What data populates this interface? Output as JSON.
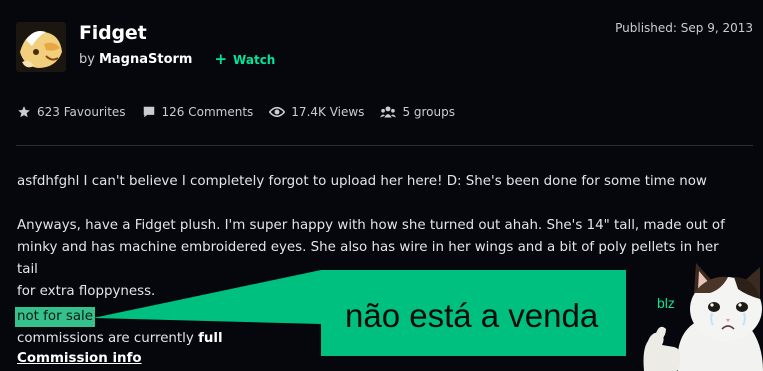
{
  "deviation": {
    "title": "Fidget",
    "by_prefix": "by",
    "author": "MagnaStorm",
    "watch_label": "Watch",
    "published": "Published: Sep 9, 2013"
  },
  "stats": {
    "favourites": "623 Favourites",
    "comments": "126 Comments",
    "views": "17.4K Views",
    "groups": "5 groups"
  },
  "description": {
    "line1": "asfdhfghl I can't believe I completely forgot to upload her here! D: She's been done for some time now",
    "para2_line1": "Anyways, have a Fidget plush. I'm super happy with how she turned out ahah. She's 14\" tall, made out of",
    "para2_line2": "minky and has machine embroidered eyes. She also has wire in her wings and a bit of poly pellets in her tail",
    "para2_line3": "for extra floppyness.",
    "not_for_sale": "not for sale",
    "commissions_prefix": "commissions are currently ",
    "commissions_status": "full",
    "commission_link": "Commission info"
  },
  "overlay": {
    "callout_text": "não está a venda",
    "meme_caption": "blz",
    "callout_color": "#00c080"
  },
  "colors": {
    "background": "#06070d",
    "accent": "#00e59b",
    "highlight": "#35c18c"
  },
  "icons": {
    "favourite": "star-icon",
    "comment": "comment-icon",
    "views": "eye-icon",
    "groups": "groups-icon"
  }
}
